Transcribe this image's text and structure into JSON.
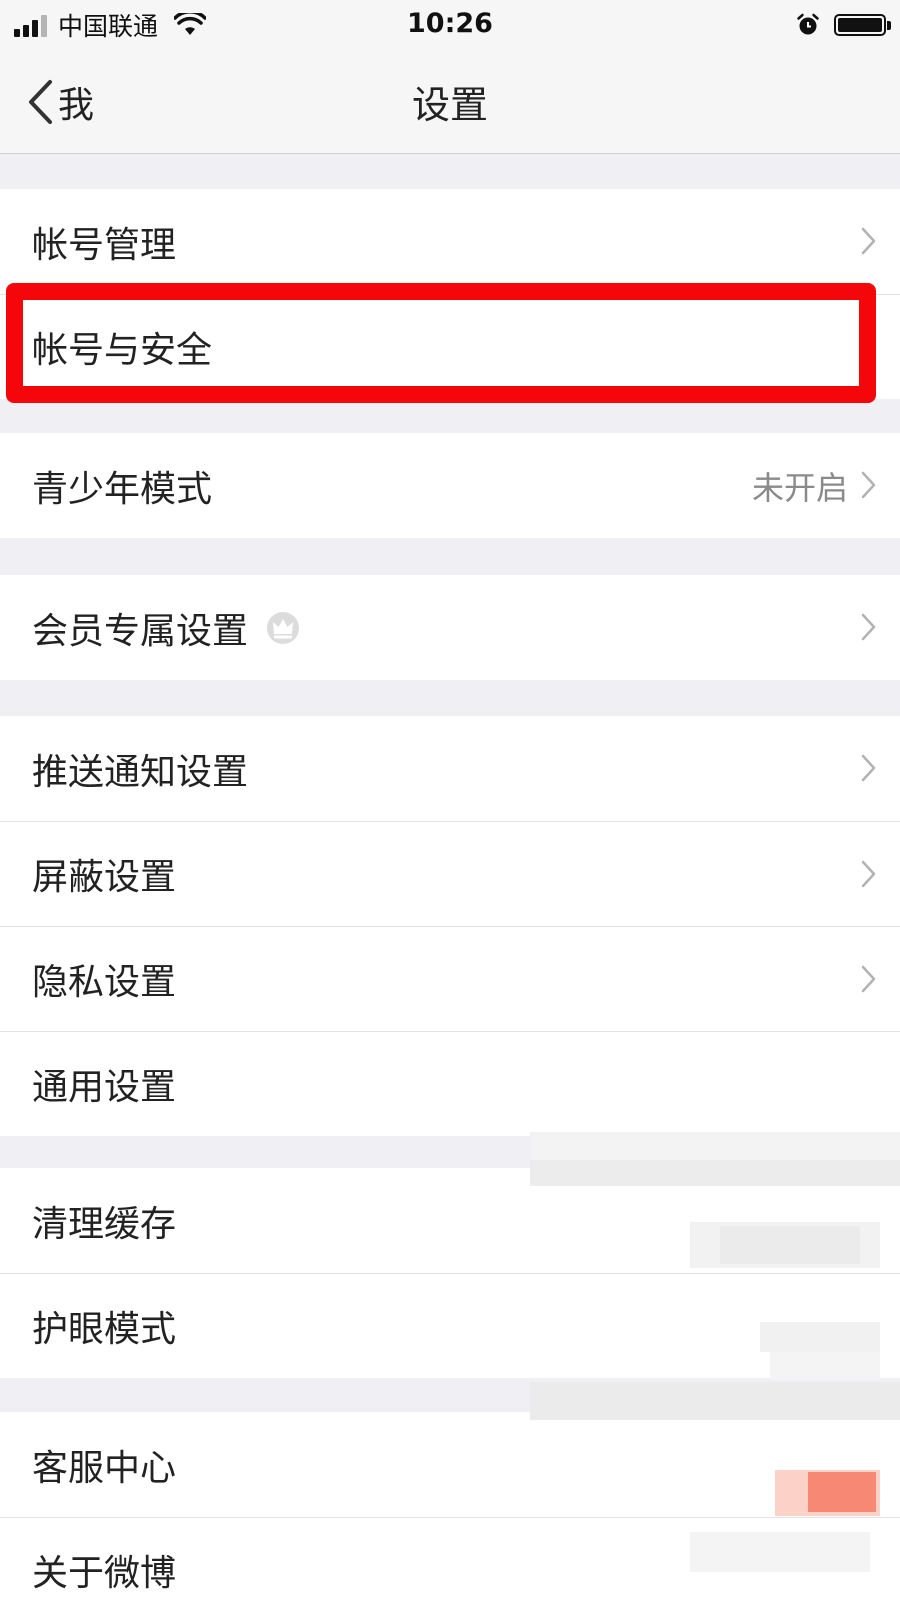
{
  "status_bar": {
    "carrier": "中国联通",
    "time": "10:26"
  },
  "nav": {
    "back_label": "我",
    "title": "设置"
  },
  "groups": [
    {
      "items": [
        {
          "label": "帐号管理"
        },
        {
          "label": "帐号与安全"
        }
      ]
    },
    {
      "items": [
        {
          "label": "青少年模式",
          "value": "未开启"
        }
      ]
    },
    {
      "items": [
        {
          "label": "会员专属设置"
        }
      ]
    },
    {
      "items": [
        {
          "label": "推送通知设置"
        },
        {
          "label": "屏蔽设置"
        },
        {
          "label": "隐私设置"
        },
        {
          "label": "通用设置"
        }
      ]
    },
    {
      "items": [
        {
          "label": "清理缓存"
        },
        {
          "label": "护眼模式"
        }
      ]
    },
    {
      "items": [
        {
          "label": "客服中心"
        },
        {
          "label": "关于微博"
        }
      ]
    }
  ],
  "colors": {
    "highlight": "#f5060a",
    "background": "#efeff4"
  }
}
